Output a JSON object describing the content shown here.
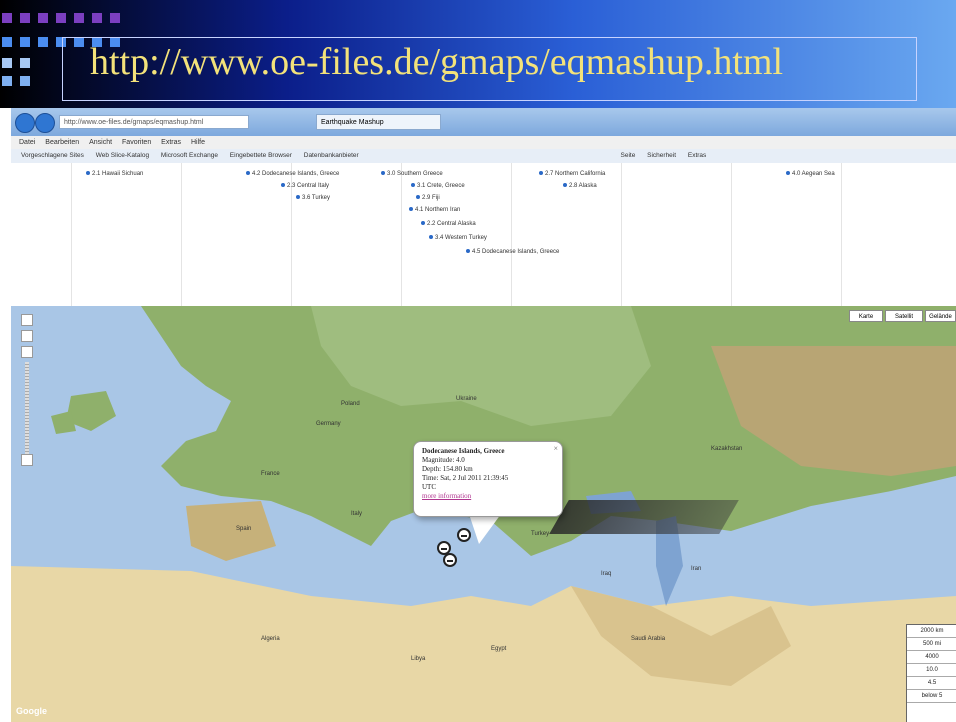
{
  "slide": {
    "url_title": "http://www.oe-files.de/gmaps/eqmashup.html",
    "colors": {
      "header_dark": "#000000",
      "header_blue": "#2a5fd6",
      "title_text": "#f3e27a",
      "square_purple": "#7b3fc0",
      "square_blue": "#4b8df0"
    }
  },
  "browser": {
    "address": "http://www.oe-files.de/gmaps/eqmashup.html",
    "tab_label": "Earthquake Mashup",
    "menu": [
      "Datei",
      "Bearbeiten",
      "Ansicht",
      "Favoriten",
      "Extras",
      "Hilfe"
    ],
    "favorites": [
      "Vorgeschlagene Sites",
      "Web Slice-Katalog",
      "Microsoft Exchange",
      "Eingebettete Browser",
      "Datenbankanbieter",
      "Seite",
      "Sicherheit",
      "Extras"
    ]
  },
  "timeline": {
    "events": [
      "2.1 Hawaii Sichuan",
      "4.2 Dodecanese Islands, Greece",
      "3.0 Southern Greece",
      "2.7 Northern California",
      "4.0 Aegean Sea",
      "2.3 Central Italy",
      "3.1 Crete, Greece",
      "2.8 Alaska",
      "3.6 Turkey",
      "2.9 Fiji",
      "4.1 Northern Iran",
      "2.2 Central Alaska",
      "3.4 Western Turkey",
      "4.5 Dodecanese Islands, Greece"
    ]
  },
  "map": {
    "maptype_buttons": [
      "Karte",
      "Satellit",
      "Gelände"
    ],
    "city_labels": [
      "Kazakhstan",
      "Poland",
      "Ukraine",
      "Spain",
      "Turkey",
      "Egypt",
      "Libya",
      "Algeria",
      "Saudi Arabia",
      "Iraq",
      "Iran",
      "Italy",
      "Germany",
      "France"
    ],
    "popup": {
      "title": "Dodecanese Islands, Greece",
      "magnitude": "Magnitude: 4.0",
      "depth": "Depth: 154.80 km",
      "time": "Time: Sat, 2 Jul 2011 21:39:45",
      "tz": "UTC",
      "link": "more information",
      "close": "×"
    },
    "scale_rows": [
      "2000 km",
      "500 mi",
      "4000",
      "10.0",
      "4.5",
      "below 5"
    ],
    "attribution": "Google"
  }
}
